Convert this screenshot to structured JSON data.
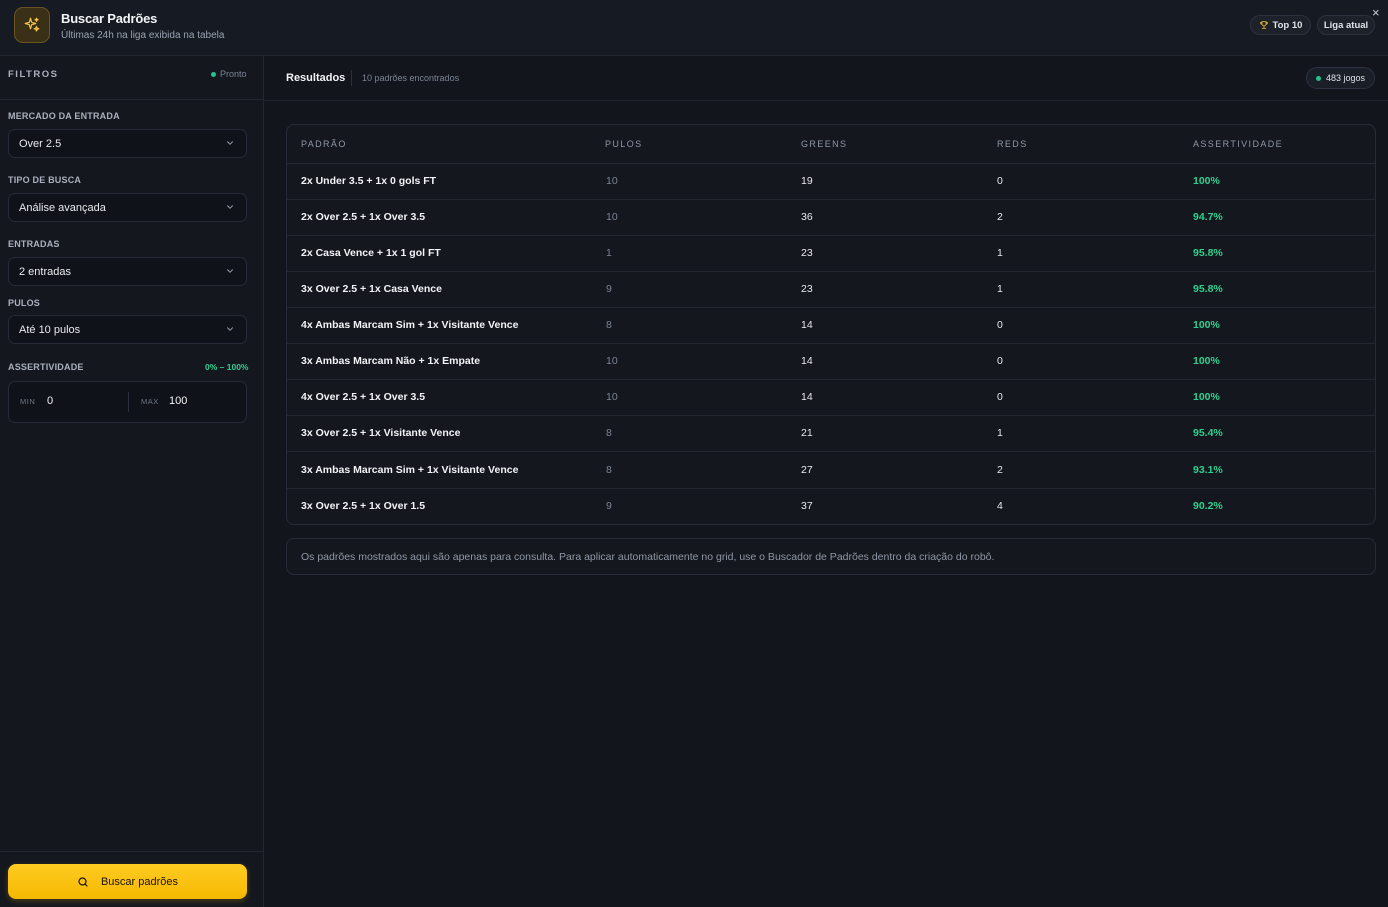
{
  "header": {
    "title": "Buscar Padrões",
    "subtitle": "Últimas 24h na liga exibida na tabela",
    "top10_label": "Top 10",
    "liga_label": "Liga atual",
    "close_symbol": "×"
  },
  "sidebar": {
    "filters_title": "FILTROS",
    "status_label": "Pronto",
    "mercado": {
      "label": "MERCADO DA ENTRADA",
      "value": "Over 2.5"
    },
    "tipo": {
      "label": "TIPO DE BUSCA",
      "value": "Análise avançada"
    },
    "entradas": {
      "label": "ENTRADAS",
      "value": "2 entradas"
    },
    "pulos": {
      "label": "PULOS",
      "value": "Até 10 pulos"
    },
    "assertividade": {
      "label": "ASSERTIVIDADE",
      "range_text": "0% – 100%",
      "min_label": "MIN",
      "min_value": "0",
      "max_label": "MAX",
      "max_value": "100"
    },
    "search_button": "Buscar padrões"
  },
  "results": {
    "title": "Resultados",
    "count_text": "10 padrões encontrados",
    "games_text": "483 jogos"
  },
  "table": {
    "columns": [
      "PADRÃO",
      "PULOS",
      "GREENS",
      "REDS",
      "ASSERTIVIDADE"
    ],
    "rows": [
      [
        "2x Under 3.5 + 1x 0 gols FT",
        "10",
        "19",
        "0",
        "100%"
      ],
      [
        "2x Over 2.5 + 1x Over 3.5",
        "10",
        "36",
        "2",
        "94.7%"
      ],
      [
        "2x Casa Vence + 1x 1 gol FT",
        "1",
        "23",
        "1",
        "95.8%"
      ],
      [
        "3x Over 2.5 + 1x Casa Vence",
        "9",
        "23",
        "1",
        "95.8%"
      ],
      [
        "4x Ambas Marcam Sim + 1x Visitante Vence",
        "8",
        "14",
        "0",
        "100%"
      ],
      [
        "3x Ambas Marcam Não + 1x Empate",
        "10",
        "14",
        "0",
        "100%"
      ],
      [
        "4x Over 2.5 + 1x Over 3.5",
        "10",
        "14",
        "0",
        "100%"
      ],
      [
        "3x Over 2.5 + 1x Visitante Vence",
        "8",
        "21",
        "1",
        "95.4%"
      ],
      [
        "3x Ambas Marcam Sim + 1x Visitante Vence",
        "8",
        "27",
        "2",
        "93.1%"
      ],
      [
        "3x Over 2.5 + 1x Over 1.5",
        "9",
        "37",
        "4",
        "90.2%"
      ]
    ]
  },
  "note": "Os padrões mostrados aqui são apenas para consulta. Para aplicar automaticamente no grid, use o Buscador de Padrões dentro da criação do robô.",
  "icons": {
    "logo": "sparkles-icon",
    "top10": "trophy-icon",
    "close": "close-icon",
    "select": "chevron-down-icon",
    "search": "search-icon"
  },
  "colors": {
    "accent": "#f5b800",
    "success": "#2fd08f",
    "background": "#12151c"
  }
}
